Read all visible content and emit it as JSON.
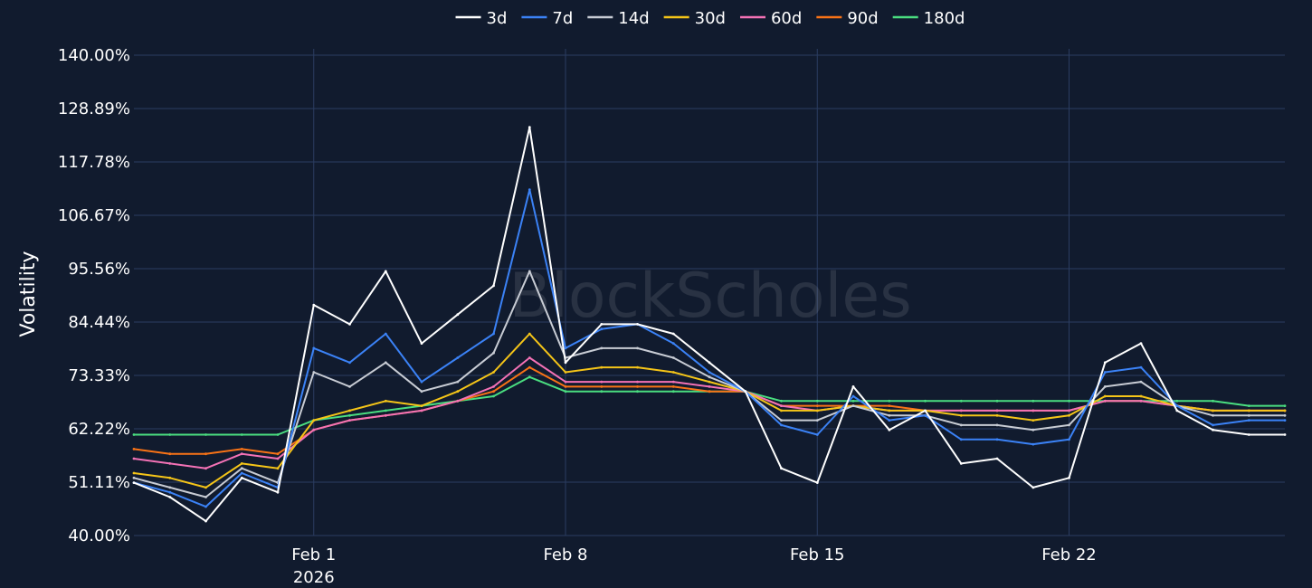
{
  "watermark": "BlockScholes",
  "chart_data": {
    "type": "line",
    "title": "",
    "xlabel": "",
    "ylabel": "Volatility",
    "ylim": [
      40,
      140
    ],
    "yticks": [
      "140.00%",
      "128.89%",
      "117.78%",
      "106.67%",
      "95.56%",
      "84.44%",
      "73.33%",
      "62.22%",
      "51.11%",
      "40.00%"
    ],
    "xlim": [
      "2026-01-27",
      "2026-02-28"
    ],
    "xticks": [
      {
        "date": "2026-02-01",
        "label": "Feb 1",
        "sublabel": "2026"
      },
      {
        "date": "2026-02-08",
        "label": "Feb 8",
        "sublabel": ""
      },
      {
        "date": "2026-02-15",
        "label": "Feb 15",
        "sublabel": ""
      },
      {
        "date": "2026-02-22",
        "label": "Feb 22",
        "sublabel": ""
      }
    ],
    "grid": true,
    "legend_position": "top-center",
    "x": [
      "2026-01-27",
      "2026-01-28",
      "2026-01-29",
      "2026-01-30",
      "2026-01-31",
      "2026-02-01",
      "2026-02-02",
      "2026-02-03",
      "2026-02-04",
      "2026-02-05",
      "2026-02-06",
      "2026-02-07",
      "2026-02-08",
      "2026-02-09",
      "2026-02-10",
      "2026-02-11",
      "2026-02-12",
      "2026-02-13",
      "2026-02-14",
      "2026-02-15",
      "2026-02-16",
      "2026-02-17",
      "2026-02-18",
      "2026-02-19",
      "2026-02-20",
      "2026-02-21",
      "2026-02-22",
      "2026-02-23",
      "2026-02-24",
      "2026-02-25",
      "2026-02-26",
      "2026-02-27",
      "2026-02-28"
    ],
    "series": [
      {
        "name": "3d",
        "color": "#ffffff",
        "values": [
          51,
          48,
          43,
          52,
          49,
          88,
          84,
          95,
          80,
          86,
          92,
          125,
          76,
          84,
          84,
          82,
          76,
          70,
          54,
          51,
          71,
          62,
          66,
          55,
          56,
          50,
          52,
          76,
          80,
          66,
          62,
          61,
          61
        ]
      },
      {
        "name": "7d",
        "color": "#3b82f6",
        "values": [
          51,
          49,
          46,
          53,
          50,
          79,
          76,
          82,
          72,
          77,
          82,
          112,
          79,
          83,
          84,
          80,
          74,
          70,
          63,
          61,
          69,
          64,
          65,
          60,
          60,
          59,
          60,
          74,
          75,
          67,
          63,
          64,
          64
        ]
      },
      {
        "name": "14d",
        "color": "#c8ccd4",
        "values": [
          52,
          50,
          48,
          54,
          51,
          74,
          71,
          76,
          70,
          72,
          78,
          95,
          77,
          79,
          79,
          77,
          73,
          70,
          64,
          64,
          67,
          65,
          65,
          63,
          63,
          62,
          63,
          71,
          72,
          67,
          65,
          65,
          65
        ]
      },
      {
        "name": "30d",
        "color": "#f5c518",
        "values": [
          53,
          52,
          50,
          55,
          54,
          64,
          66,
          68,
          67,
          70,
          74,
          82,
          74,
          75,
          75,
          74,
          72,
          70,
          66,
          66,
          67,
          66,
          66,
          65,
          65,
          64,
          65,
          69,
          69,
          67,
          66,
          66,
          66
        ]
      },
      {
        "name": "60d",
        "color": "#f472b6",
        "values": [
          56,
          55,
          54,
          57,
          56,
          62,
          64,
          65,
          66,
          68,
          71,
          77,
          72,
          72,
          72,
          72,
          71,
          70,
          67,
          66,
          67,
          66,
          66,
          66,
          66,
          66,
          66,
          68,
          68,
          67,
          66,
          66,
          66
        ]
      },
      {
        "name": "90d",
        "color": "#f97316",
        "values": [
          58,
          57,
          57,
          58,
          57,
          62,
          64,
          65,
          66,
          68,
          70,
          75,
          71,
          71,
          71,
          71,
          70,
          70,
          67,
          67,
          67,
          67,
          66,
          66,
          66,
          66,
          66,
          68,
          68,
          67,
          66,
          66,
          66
        ]
      },
      {
        "name": "180d",
        "color": "#4ade80",
        "values": [
          61,
          61,
          61,
          61,
          61,
          64,
          65,
          66,
          67,
          68,
          69,
          73,
          70,
          70,
          70,
          70,
          70,
          70,
          68,
          68,
          68,
          68,
          68,
          68,
          68,
          68,
          68,
          68,
          68,
          68,
          68,
          67,
          67
        ]
      }
    ]
  }
}
